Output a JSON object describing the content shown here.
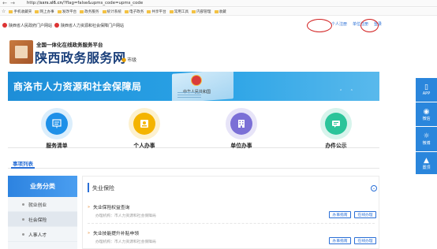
{
  "browser": {
    "url_prefix": "http://",
    "url_host": "sxrs.sl6.cn",
    "url_path": "/?flag=false&upms_code=upms_code",
    "bookmarks": [
      "手机收藏夹",
      "网上办事",
      "发改平台",
      "政务服务",
      "统计系统",
      "电子政务",
      "共享平台",
      "常用工具",
      "内部管理",
      "收藏"
    ]
  },
  "topbar": {
    "gov_portal": "陕西省人民政府门户网站",
    "hr_portal": "陕西省人力资源和社会保障门户网站",
    "personal_register": "个人注册",
    "org_register": "单位注册",
    "login": "登录"
  },
  "brand": {
    "subtitle": "全国一体化在线政务服务平台",
    "title": "陕西政务服务网",
    "city": "市级"
  },
  "banner": {
    "title": "商洛市人力资源和社会保障局",
    "card_text": "中华人民共和国"
  },
  "services": [
    {
      "label": "服务清单",
      "icon": "service-list-icon",
      "color": "#1e90e8"
    },
    {
      "label": "个人办事",
      "icon": "personal-icon",
      "color": "#f4b400"
    },
    {
      "label": "单位办事",
      "icon": "building-icon",
      "color": "#7b6fd6"
    },
    {
      "label": "办件公示",
      "icon": "message-icon",
      "color": "#2bc49a"
    }
  ],
  "tabs": {
    "active": "事项列表"
  },
  "sidebar": {
    "header": "业务分类",
    "items": [
      "就业创业",
      "社会保险",
      "人事人才"
    ]
  },
  "main": {
    "title": "失业保险",
    "items": [
      {
        "title": "失业保险权益查询",
        "dept_label": "办理机构：",
        "dept": "市人力资源和社会保障局",
        "guide_button": "办事指南",
        "apply_button": "在线办理"
      },
      {
        "title": "失业技能提升补贴申领",
        "dept_label": "办理机构：",
        "dept": "市人力资源和社会保障局",
        "guide_button": "办事指南",
        "apply_button": "在线办理"
      }
    ]
  },
  "float_panel": [
    {
      "label": "APP",
      "icon": "phone-icon"
    },
    {
      "label": "微信",
      "icon": "wechat-icon"
    },
    {
      "label": "微博",
      "icon": "weibo-icon"
    },
    {
      "label": "置顶",
      "icon": "top-arrow-icon"
    }
  ]
}
